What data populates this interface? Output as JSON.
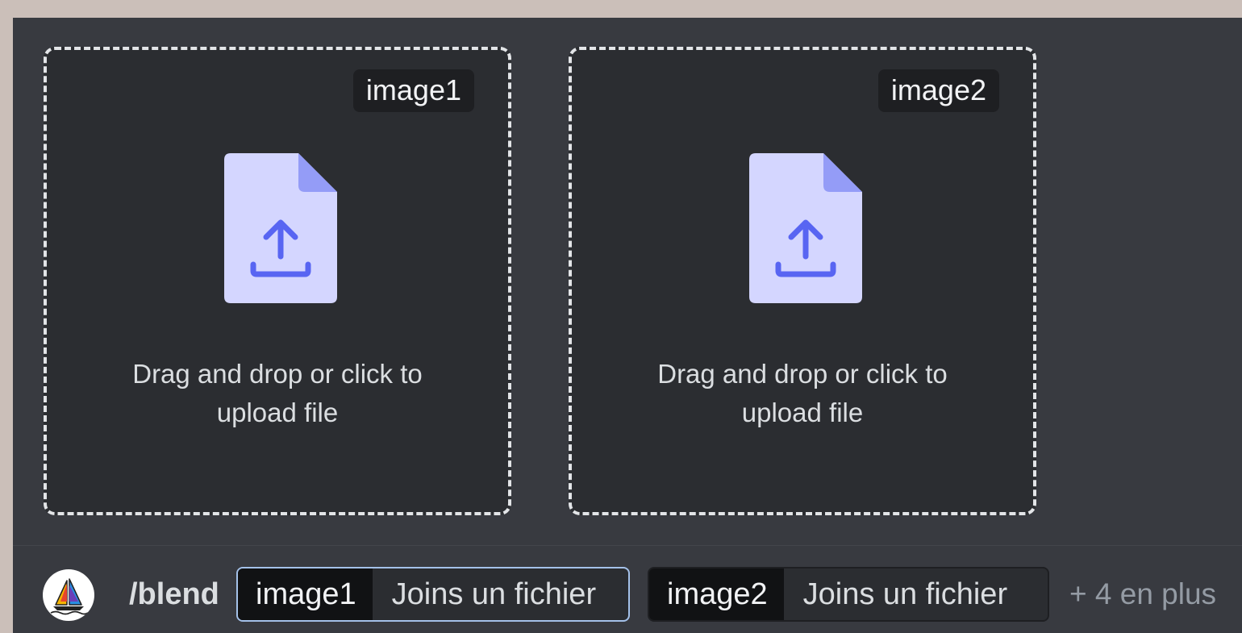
{
  "dropzones": [
    {
      "label": "image1",
      "text_line1": "Drag and drop or click to",
      "text_line2": "upload file"
    },
    {
      "label": "image2",
      "text_line1": "Drag and drop or click to",
      "text_line2": "upload file"
    }
  ],
  "command": {
    "name": "/blend",
    "options": [
      {
        "key": "image1",
        "value": "Joins un fichier"
      },
      {
        "key": "image2",
        "value": "Joins un fichier"
      }
    ],
    "more": "+ 4 en plus"
  },
  "icons": {
    "file_upload": "file-upload-icon",
    "bot_avatar": "sailboat-avatar"
  },
  "colors": {
    "panel_bg": "#383a40",
    "dropzone_bg": "#2b2d31",
    "accent": "#5865f2",
    "icon_page": "#d4d6ff",
    "active_border": "#a4c1e9"
  }
}
